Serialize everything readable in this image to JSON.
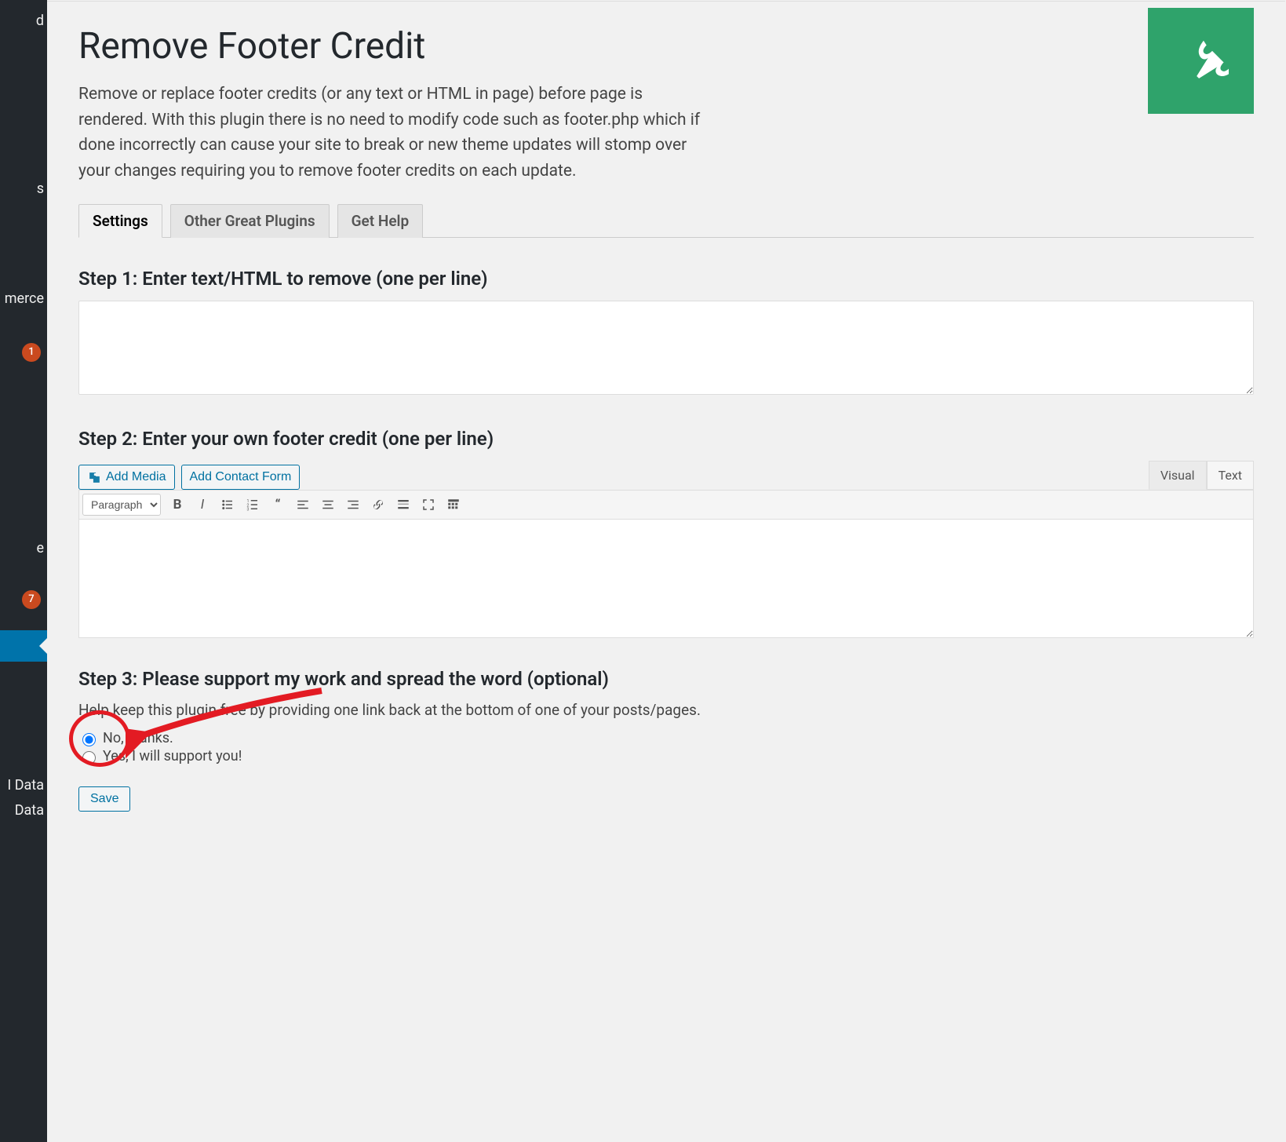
{
  "sidebar": {
    "items": [
      {
        "label": "d"
      },
      {
        "label": "s"
      },
      {
        "label": "merce"
      },
      {
        "label": "e"
      },
      {
        "label": "I Data"
      },
      {
        "label": "Data"
      }
    ],
    "badges": {
      "first": "1",
      "second": "7"
    }
  },
  "page": {
    "title": "Remove Footer Credit",
    "description": "Remove or replace footer credits (or any text or HTML in page) before page is rendered. With this plugin there is no need to modify code such as footer.php which if done incorrectly can cause your site to break or new theme updates will stomp over your changes requiring you to remove footer credits on each update."
  },
  "tabs": [
    {
      "label": "Settings",
      "active": true
    },
    {
      "label": "Other Great Plugins",
      "active": false
    },
    {
      "label": "Get Help",
      "active": false
    }
  ],
  "step1": {
    "heading": "Step 1: Enter text/HTML to remove (one per line)",
    "value": ""
  },
  "step2": {
    "heading": "Step 2: Enter your own footer credit (one per line)",
    "add_media_label": "Add Media",
    "add_contact_label": "Add Contact Form",
    "mode_visual": "Visual",
    "mode_text": "Text",
    "paragraph_label": "Paragraph"
  },
  "step3": {
    "heading": "Step 3: Please support my work and spread the word (optional)",
    "help": "Help keep this plugin free by providing one link back at the bottom of one of your posts/pages.",
    "option_no": "No, thanks.",
    "option_yes": "Yes, I will support you!",
    "selected": "no"
  },
  "save_label": "Save",
  "colors": {
    "accent": "#0071a1",
    "brand_green": "#2fa36b",
    "annotation": "#e31b23"
  }
}
